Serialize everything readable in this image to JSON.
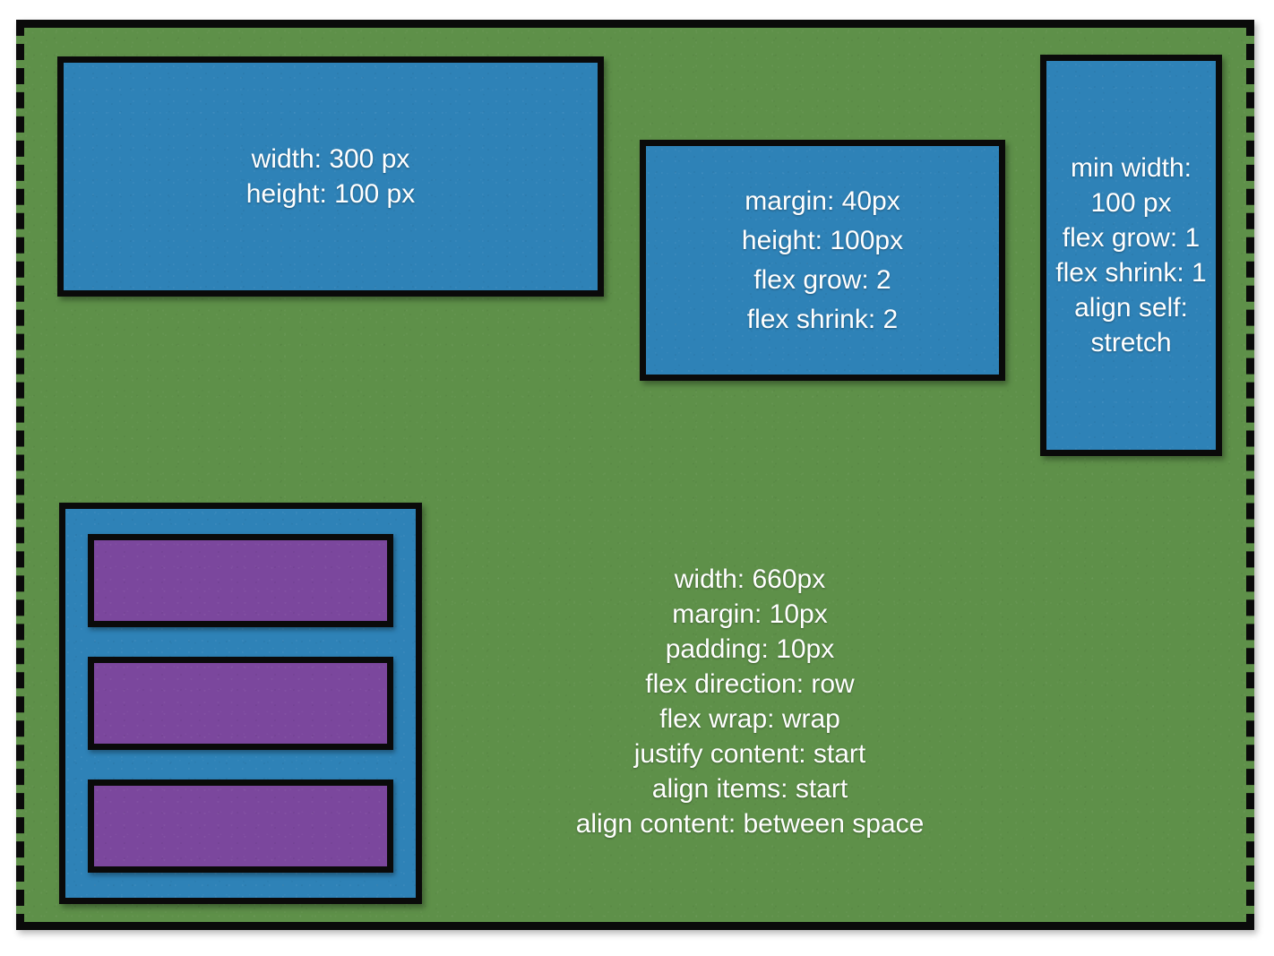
{
  "diagram": {
    "title": "CSS Flexbox layout diagram",
    "colors": {
      "container_background": "#5e9049",
      "item_background": "#2e82b7",
      "nested_item_background": "#7b479d",
      "border": "#0a0a0a",
      "text": "#ffffff"
    },
    "container": {
      "name": "flex-container",
      "border_style_sides": "dashed",
      "border_style_top_bottom": "solid",
      "properties": [
        "width: 660px",
        "margin: 10px",
        "padding: 10px",
        "flex direction: row",
        "flex wrap: wrap",
        "justify content: start",
        "align items: start",
        "align content: between space"
      ]
    },
    "items": [
      {
        "name": "item-one",
        "properties": [
          "width: 300 px",
          "height:  100 px"
        ]
      },
      {
        "name": "item-two",
        "properties": [
          "margin: 40px",
          "height: 100px",
          "flex grow: 2",
          "flex shrink: 2"
        ]
      },
      {
        "name": "item-three",
        "properties": [
          "min width:",
          "100 px",
          "flex grow: 1",
          "flex shrink: 1",
          "align self:",
          "stretch"
        ]
      }
    ],
    "nested": {
      "name": "nested-flex-container",
      "item_count": 3,
      "items": [
        {
          "name": "nested-item-1",
          "label": ""
        },
        {
          "name": "nested-item-2",
          "label": ""
        },
        {
          "name": "nested-item-3",
          "label": ""
        }
      ]
    }
  }
}
